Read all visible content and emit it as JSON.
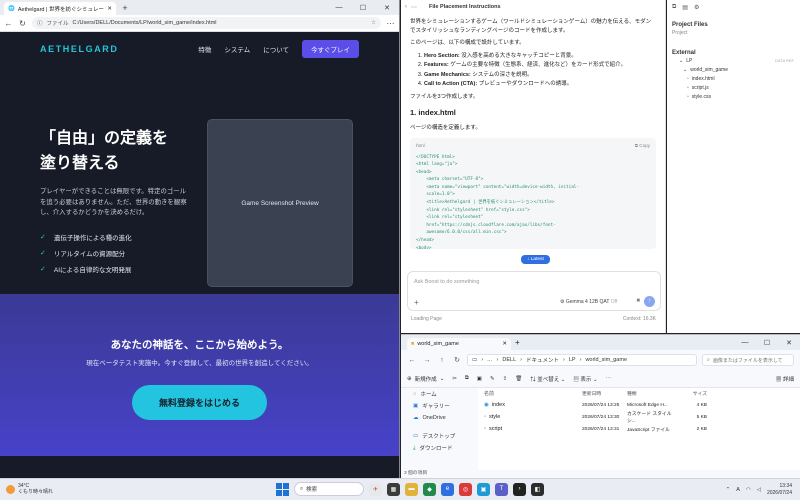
{
  "browser": {
    "tab_title": "Aethelgard | 世界を紡ぐシミュレーシ…",
    "close": "✕",
    "new_tab": "+",
    "url_label": "ファイル",
    "url": "C:/Users/DELL/Documents/LP/world_sim_game/index.html"
  },
  "lp": {
    "logo": "AETHELGARD",
    "nav": [
      "特徴",
      "システム",
      "について"
    ],
    "cta": "今すぐプレイ",
    "hero_title_1": "「自由」の定義を",
    "hero_title_2": "塗り替える",
    "hero_desc": "プレイヤーができることは無限です。特定のゴールを追う必要はありません。ただ、世界の動きを観察し、介入するかどうかを決めるだけ。",
    "features": [
      "遺伝子操作による種の進化",
      "リアルタイムの資源配分",
      "AIによる自律的な文明発展"
    ],
    "preview": "Game Screenshot Preview",
    "cta_title": "あなたの神話を、ここから始めよう。",
    "cta_sub": "現在ベータテスト実施中。今すぐ登録して、最初の世界を創造してください。",
    "cta_button": "無料登録をはじめる"
  },
  "chat": {
    "title": "File Placement Instructions",
    "intro": "世界をシミュレーションするゲーム（ワールドシミュレーションゲーム）の魅力を伝える、モダンでスタイリッシュなランディングページのコードを作成します。",
    "design": "このページは、以下の構成で設計しています。",
    "items": [
      {
        "b": "Hero Section:",
        "t": " 没入感を高める大きなキャッチコピーと背景。"
      },
      {
        "b": "Features:",
        "t": " ゲームの主要な特徴（生態系、経済、進化など）をカード形式で紹介。"
      },
      {
        "b": "Game Mechanics:",
        "t": " システムの深さを説明。"
      },
      {
        "b": "Call to Action (CTA):",
        "t": " プレビューやダウンロードへの誘導。"
      }
    ],
    "files_note": "ファイルを3つ作成します。",
    "section_title": "1. index.html",
    "section_desc": "ページの構造を定義します。",
    "code_lang": "html",
    "copy": "Copy",
    "code": "<!DOCTYPE html>\n<html lang=\"ja\">\n<head>\n    <meta charset=\"UTF-8\">\n    <meta name=\"viewport\" content=\"width=device-width, initial-\n    scale=1.0\">\n    <title>Aethelgard | 世界を紡ぐシミュレーション</title>\n    <link rel=\"stylesheet\" href=\"style.css\">\n    <link rel=\"stylesheet\"\n    href=\"https://cdnjs.cloudflare.com/ajax/libs/font-\n    awesome/6.0.0/css/all.min.css\">\n</head>\n<body>\n    <header>",
    "latest": "↓ Latest",
    "input_placeholder": "Ask Boost to do something",
    "model": "Gemma 4 12B QAT",
    "model_extra": "Off",
    "footer_left": "Loading Page",
    "footer_right": "Context: 16.3K"
  },
  "side": {
    "project_files": "Project Files",
    "project_sub": "Project",
    "external": "External",
    "folder": "LP",
    "folder_tag": "DATA REF",
    "subfolder": "world_sim_game",
    "files": [
      "index.html",
      "script.js",
      "style.css"
    ]
  },
  "explorer": {
    "tab_title": "world_sim_game",
    "path": [
      "DELL",
      "ドキュメント",
      "LP",
      "world_sim_game"
    ],
    "search_placeholder": "画像またはファイルを表示して",
    "new_button": "新規作成",
    "sort": "並べ替え",
    "view": "表示",
    "details": "詳細",
    "nav": [
      "ホーム",
      "ギャラリー",
      "OneDrive",
      "デスクトップ",
      "ダウンロード"
    ],
    "headers": [
      "名前",
      "更新日時",
      "種類",
      "サイズ"
    ],
    "rows": [
      {
        "name": "index",
        "date": "2026/07/24 13:25",
        "type": "Microsoft Edge H...",
        "size": "4 KB"
      },
      {
        "name": "style",
        "date": "2026/07/24 13:30",
        "type": "カスケード スタイル シ...",
        "size": "5 KB"
      },
      {
        "name": "script",
        "date": "2026/07/24 13:31",
        "type": "JavaScript ファイル",
        "size": "2 KB"
      }
    ],
    "status": "3 個の項目"
  },
  "taskbar": {
    "temp": "34°C",
    "weather": "くもり時々晴れ",
    "search": "検索",
    "time": "13:34",
    "date": "2026/07/24",
    "lang": "A"
  }
}
